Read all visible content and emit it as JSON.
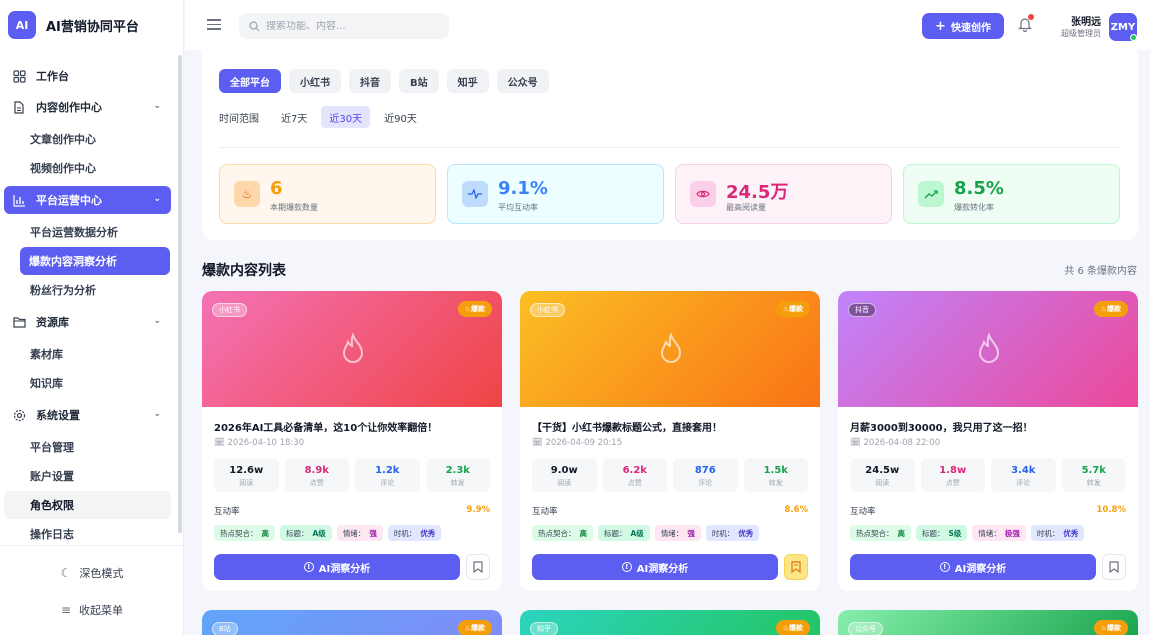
{
  "app": {
    "logo": "AI",
    "title": "AI营销协同平台"
  },
  "sidebar": {
    "items": [
      {
        "label": "工作台"
      },
      {
        "label": "内容创作中心"
      },
      {
        "label": "文章创作中心"
      },
      {
        "label": "视频创作中心"
      },
      {
        "label": "平台运营中心"
      },
      {
        "label": "平台运营数据分析"
      },
      {
        "label": "爆款内容洞察分析"
      },
      {
        "label": "粉丝行为分析"
      },
      {
        "label": "资源库"
      },
      {
        "label": "素材库"
      },
      {
        "label": "知识库"
      },
      {
        "label": "系统设置"
      },
      {
        "label": "平台管理"
      },
      {
        "label": "账户设置"
      },
      {
        "label": "角色权限"
      },
      {
        "label": "操作日志"
      }
    ],
    "dark_mode": "深色模式",
    "collapse": "收起菜单"
  },
  "header": {
    "search_placeholder": "搜索功能、内容...",
    "quick_create": "快速创作",
    "user_name": "张明远",
    "user_role": "超级管理员",
    "avatar": "ZMY"
  },
  "filters": {
    "platforms": [
      "全部平台",
      "小红书",
      "抖音",
      "B站",
      "知乎",
      "公众号"
    ],
    "time_label": "时间范围",
    "time_options": [
      "近7天",
      "近30天",
      "近90天"
    ]
  },
  "stats": [
    {
      "value": "6",
      "label": "本期爆款数量",
      "color": "#f59e0b"
    },
    {
      "value": "9.1%",
      "label": "平均互动率",
      "color": "#3b82f6"
    },
    {
      "value": "24.5万",
      "label": "最高阅读量",
      "color": "#db2777"
    },
    {
      "value": "8.5%",
      "label": "爆款转化率",
      "color": "#16a34a"
    }
  ],
  "list": {
    "title": "爆款内容列表",
    "count": "共 6 条爆款内容"
  },
  "cards": [
    {
      "platform": "小红书",
      "hot": "爆款",
      "title": "2026年AI工具必备清单，这10个让你效率翻倍！",
      "date": "2026-04-10 18:30",
      "metrics": [
        {
          "value": "12.6w",
          "label": "阅读",
          "color": "#111827"
        },
        {
          "value": "8.9k",
          "label": "点赞",
          "color": "#db2777"
        },
        {
          "value": "1.2k",
          "label": "评论",
          "color": "#2563eb"
        },
        {
          "value": "2.3k",
          "label": "转发",
          "color": "#16a34a"
        }
      ],
      "rate_label": "互动率",
      "rate": "9.9%",
      "tags": [
        {
          "k": "热点契合：",
          "v": "高"
        },
        {
          "k": "标题：",
          "v": "A级"
        },
        {
          "k": "情绪：",
          "v": "强"
        },
        {
          "k": "时机：",
          "v": "优秀"
        }
      ],
      "ai_button": "AI洞察分析"
    },
    {
      "platform": "小红书",
      "hot": "爆款",
      "title": "【干货】小红书爆款标题公式，直接套用！",
      "date": "2026-04-09 20:15",
      "metrics": [
        {
          "value": "9.0w",
          "label": "阅读",
          "color": "#111827"
        },
        {
          "value": "6.2k",
          "label": "点赞",
          "color": "#db2777"
        },
        {
          "value": "876",
          "label": "评论",
          "color": "#2563eb"
        },
        {
          "value": "1.5k",
          "label": "转发",
          "color": "#16a34a"
        }
      ],
      "rate_label": "互动率",
      "rate": "8.6%",
      "tags": [
        {
          "k": "热点契合：",
          "v": "高"
        },
        {
          "k": "标题：",
          "v": "A级"
        },
        {
          "k": "情绪：",
          "v": "强"
        },
        {
          "k": "时机：",
          "v": "优秀"
        }
      ],
      "ai_button": "AI洞察分析"
    },
    {
      "platform": "抖音",
      "hot": "爆款",
      "title": "月薪3000到30000，我只用了这一招！",
      "date": "2026-04-08 22:00",
      "metrics": [
        {
          "value": "24.5w",
          "label": "阅读",
          "color": "#111827"
        },
        {
          "value": "1.8w",
          "label": "点赞",
          "color": "#db2777"
        },
        {
          "value": "3.4k",
          "label": "评论",
          "color": "#2563eb"
        },
        {
          "value": "5.7k",
          "label": "转发",
          "color": "#16a34a"
        }
      ],
      "rate_label": "互动率",
      "rate": "10.8%",
      "tags": [
        {
          "k": "热点契合：",
          "v": "高"
        },
        {
          "k": "标题：",
          "v": "S级"
        },
        {
          "k": "情绪：",
          "v": "极强"
        },
        {
          "k": "时机：",
          "v": "优秀"
        }
      ],
      "ai_button": "AI洞察分析"
    }
  ],
  "cards_row2": [
    {
      "platform": "B站",
      "hot": "爆款"
    },
    {
      "platform": "知乎",
      "hot": "爆款"
    },
    {
      "platform": "公众号",
      "hot": "爆款"
    }
  ]
}
